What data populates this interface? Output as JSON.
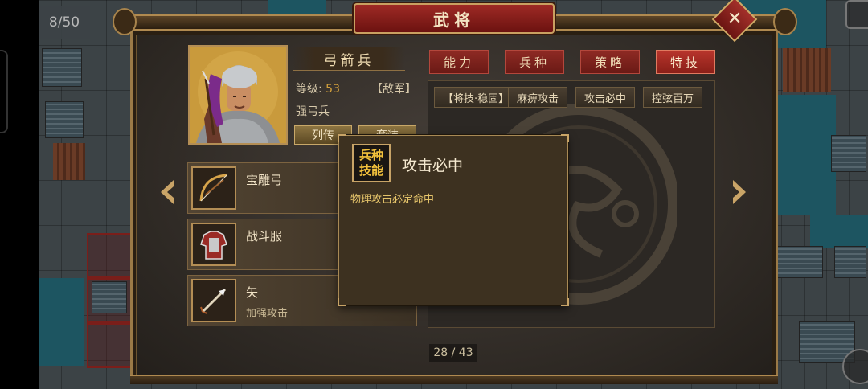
{
  "hud": {
    "turn_counter": "8/50"
  },
  "dialog": {
    "title": "武将",
    "close_label": "✕"
  },
  "general": {
    "name": "弓箭兵",
    "level_label": "等级:",
    "level_value": "53",
    "faction": "【敌军】",
    "unit_type": "强弓兵",
    "biography_label": "列传",
    "outfit_label": "套装"
  },
  "equipment": [
    {
      "name": "宝雕弓",
      "desc": "",
      "icon": "bow-icon"
    },
    {
      "name": "战斗服",
      "desc": "",
      "icon": "armor-icon"
    },
    {
      "name": "矢",
      "desc": "加强攻击",
      "icon": "arrow-icon"
    }
  ],
  "tabs": [
    {
      "label": "能力",
      "active": false
    },
    {
      "label": "兵种",
      "active": false
    },
    {
      "label": "策略",
      "active": false
    },
    {
      "label": "特技",
      "active": true
    }
  ],
  "skills": [
    {
      "label": "【将技·稳固】"
    },
    {
      "label": "麻痹攻击"
    },
    {
      "label": "攻击必中"
    },
    {
      "label": "控弦百万"
    }
  ],
  "tooltip": {
    "badge_line1": "兵种",
    "badge_line2": "技能",
    "title": "攻击必中",
    "description": "物理攻击必定命中"
  },
  "pagination": {
    "text": "28 / 43"
  },
  "colors": {
    "accent_red": "#9e2a25",
    "gold": "#c8a467",
    "panel": "#2e2924"
  }
}
